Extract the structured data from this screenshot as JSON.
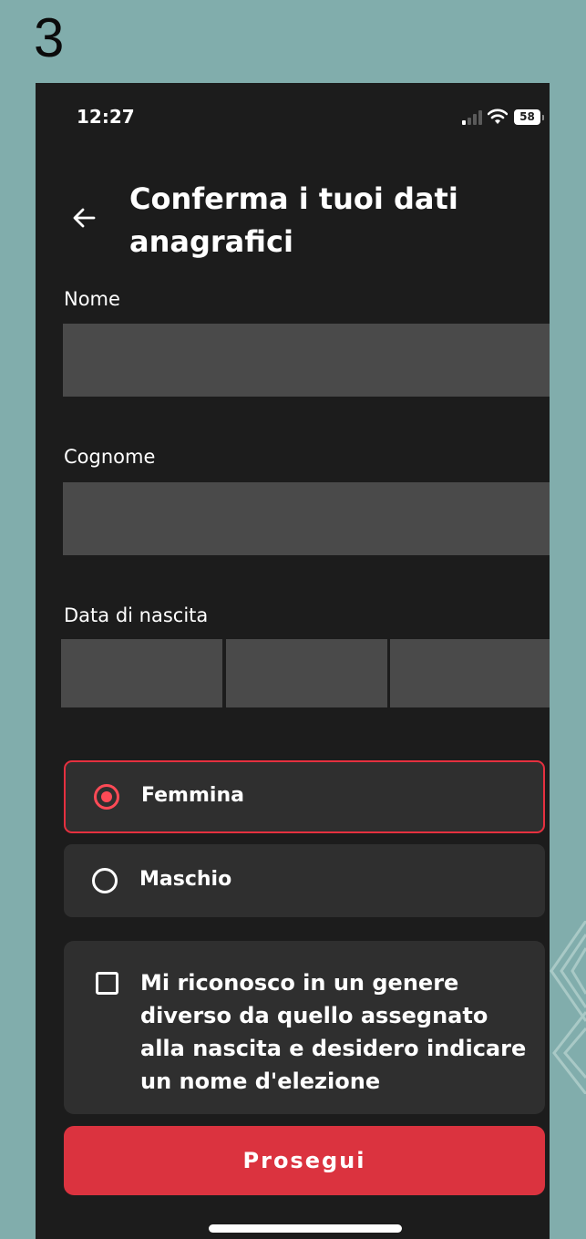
{
  "step_label": "3",
  "status_bar": {
    "time": "12:27",
    "battery": "58"
  },
  "header": {
    "title": "Conferma i tuoi dati anagrafici"
  },
  "form": {
    "first_name": {
      "label": "Nome",
      "value": ""
    },
    "last_name": {
      "label": "Cognome",
      "value": ""
    },
    "birth_date": {
      "label": "Data di nascita",
      "day": "",
      "month": "",
      "year": ""
    },
    "gender_options": [
      {
        "label": "Femmina",
        "selected": true
      },
      {
        "label": "Maschio",
        "selected": false
      }
    ],
    "chosen_name_checkbox": {
      "label": "Mi riconosco in un genere diverso da quello assegnato alla nascita e desidero indicare un nome d'elezione",
      "checked": false
    }
  },
  "actions": {
    "continue_label": "Prosegui"
  },
  "colors": {
    "background": "#81adac",
    "screen": "#1c1c1c",
    "field": "#4a4a4a",
    "option_card": "#2f2f2f",
    "accent_red": "#db333f"
  },
  "icons": [
    "back-arrow-icon",
    "signal-icon",
    "wifi-icon",
    "battery-icon",
    "radio-selected-icon",
    "radio-empty-icon",
    "checkbox-icon"
  ]
}
